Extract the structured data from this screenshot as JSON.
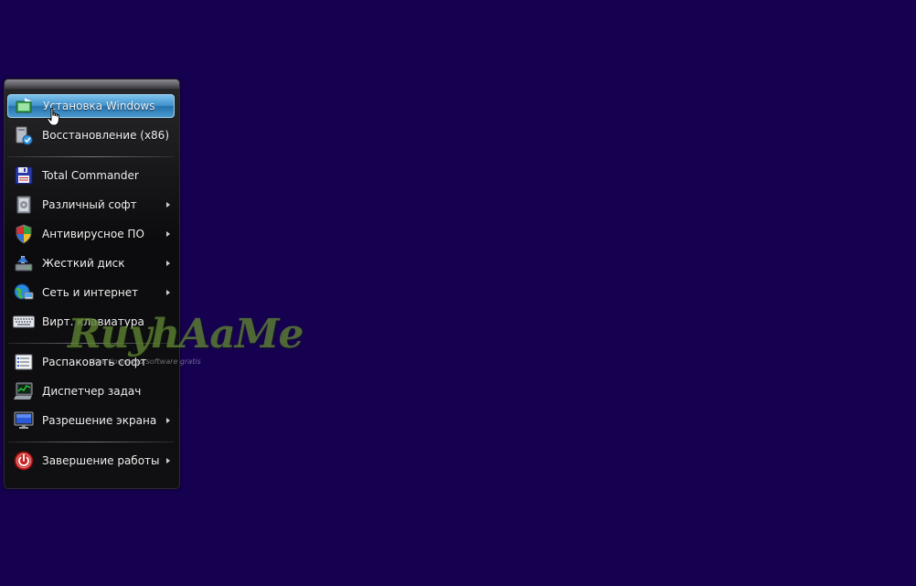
{
  "menu": {
    "items": [
      {
        "label": "Установка Windows",
        "icon": "windows-install-icon",
        "submenu": false,
        "selected": true
      },
      {
        "label": "Восстановление (x86)",
        "icon": "restore-icon",
        "submenu": false
      },
      {
        "label": "Total Commander",
        "icon": "floppy-disk-icon",
        "submenu": false
      },
      {
        "label": "Различный софт",
        "icon": "software-box-icon",
        "submenu": true
      },
      {
        "label": "Антивирусное ПО",
        "icon": "shield-icon",
        "submenu": true
      },
      {
        "label": "Жесткий диск",
        "icon": "hard-disk-icon",
        "submenu": true
      },
      {
        "label": "Сеть и интернет",
        "icon": "network-globe-icon",
        "submenu": true
      },
      {
        "label": "Вирт. клавиатура",
        "icon": "keyboard-icon",
        "submenu": false
      },
      {
        "label": "Распаковать софт",
        "icon": "unpack-list-icon",
        "submenu": false
      },
      {
        "label": "Диспетчер задач",
        "icon": "task-manager-icon",
        "submenu": false
      },
      {
        "label": "Разрешение экрана",
        "icon": "monitor-icon",
        "submenu": true
      },
      {
        "label": "Завершение работы",
        "icon": "power-icon",
        "submenu": true
      }
    ]
  },
  "watermark": {
    "text": "RuyhAaMe",
    "subtext": "free download software gratis"
  },
  "colors": {
    "desktop": "#160050",
    "selection": "#3f92cc"
  }
}
